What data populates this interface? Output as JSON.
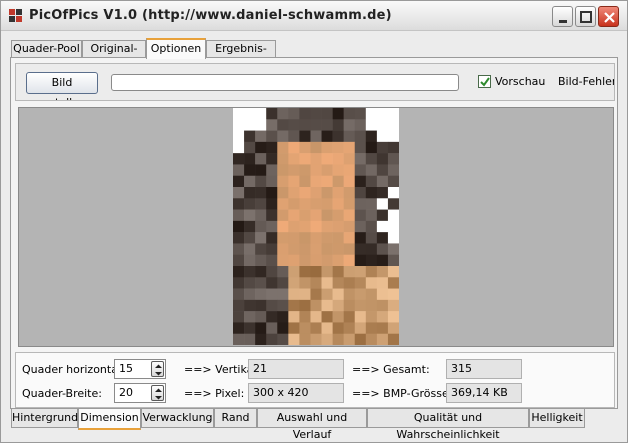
{
  "window": {
    "title": "PicOfPics V1.0 (http://www.daniel-schwamm.de)",
    "icon": "app-logo-icon",
    "controls": [
      "minimize-icon",
      "maximize-icon",
      "close-icon"
    ]
  },
  "main_tabs": [
    {
      "label": "Quader-Pool",
      "active": false
    },
    {
      "label": "Original-Bild",
      "active": false
    },
    {
      "label": "Optionen",
      "active": true
    },
    {
      "label": "Ergebnis-Bild",
      "active": false
    }
  ],
  "toolbar": {
    "create_button": "Bild erstellen",
    "progress_value": 0,
    "preview_checked": true,
    "preview_label": "Vorschau",
    "error_label": "Bild-Fehler-S"
  },
  "preview": {
    "description_icon": "mosaic-image",
    "grid_cols": 15,
    "grid_rows": 21
  },
  "settings": {
    "horizontal_label": "Quader horizontal:",
    "horizontal_value": "15",
    "width_label": "Quader-Breite:",
    "width_value": "20",
    "vertical_label": "==> Vertikal:",
    "vertical_value": "21",
    "pixel_label": "==> Pixel:",
    "pixel_value": "300 x 420",
    "total_label": "==> Gesamt:",
    "total_value": "315",
    "bmp_label": "==> BMP-Grösse:",
    "bmp_value": "369,14 KB"
  },
  "bottom_tabs": [
    {
      "label": "Hintergrund",
      "active": false
    },
    {
      "label": "Dimension",
      "active": true
    },
    {
      "label": "Verwacklung",
      "active": false
    },
    {
      "label": "Rand",
      "active": false
    },
    {
      "label": "Auswahl und Verlauf",
      "active": false
    },
    {
      "label": "Qualität und Wahrscheinlichkeit",
      "active": false
    },
    {
      "label": "Helligkeit",
      "active": false
    }
  ],
  "colors": {
    "tab_accent": "#e8a13a",
    "check_mark": "#2e8b2e",
    "close_button": "#c8321d"
  }
}
